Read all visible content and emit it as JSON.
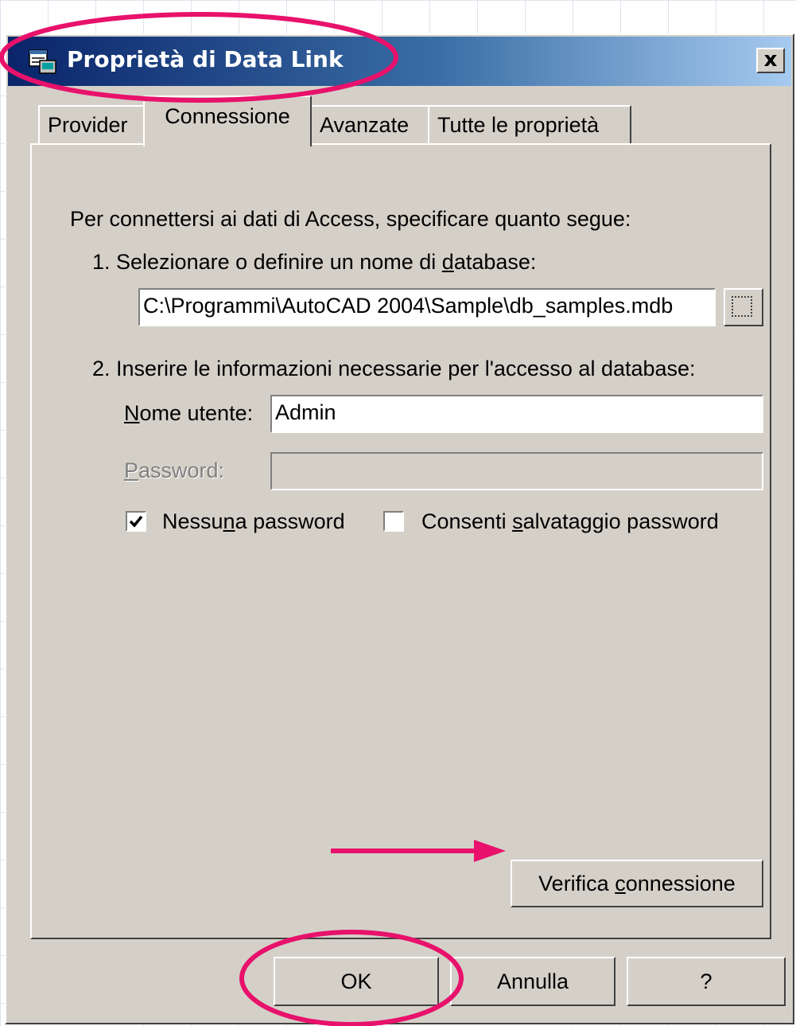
{
  "window": {
    "title": "Proprietà di Data Link",
    "close_label": "x"
  },
  "tabs": [
    {
      "label": "Provider",
      "active": false
    },
    {
      "label": "Connessione",
      "active": true
    },
    {
      "label": "Avanzate",
      "active": false
    },
    {
      "label": "Tutte le proprietà",
      "active": false
    }
  ],
  "connection": {
    "intro": "Per connettersi ai dati di Access, specificare quanto segue:",
    "step1": {
      "before": "1. Selezionare o definire un nome di ",
      "mnemonic": "d",
      "after": "atabase:"
    },
    "database_path": "C:\\Programmi\\AutoCAD 2004\\Sample\\db_samples.mdb",
    "browse_label": "...",
    "step2": "2. Inserire le informazioni necessarie per l'accesso al database:",
    "username_label": {
      "mnemonic": "N",
      "after": "ome utente:"
    },
    "username_value": "Admin",
    "password_label": {
      "mnemonic": "P",
      "after": "assword:"
    },
    "password_value": "",
    "no_password": {
      "before": "Nessu",
      "mnemonic": "n",
      "after": "a password",
      "checked": true
    },
    "allow_save": {
      "before": "Consenti ",
      "mnemonic": "s",
      "after": "alvataggio password",
      "checked": false
    },
    "test_button": {
      "before": "Verifica ",
      "mnemonic": "c",
      "after": "onnessione"
    }
  },
  "footer": {
    "ok_label": "OK",
    "cancel_label": "Annulla",
    "help_label": "?"
  },
  "annotations": {
    "highlight_color": "#e8116b",
    "markers": [
      "ellipse around title bar",
      "arrow pointing to Verifica connessione",
      "ellipse around OK"
    ]
  }
}
